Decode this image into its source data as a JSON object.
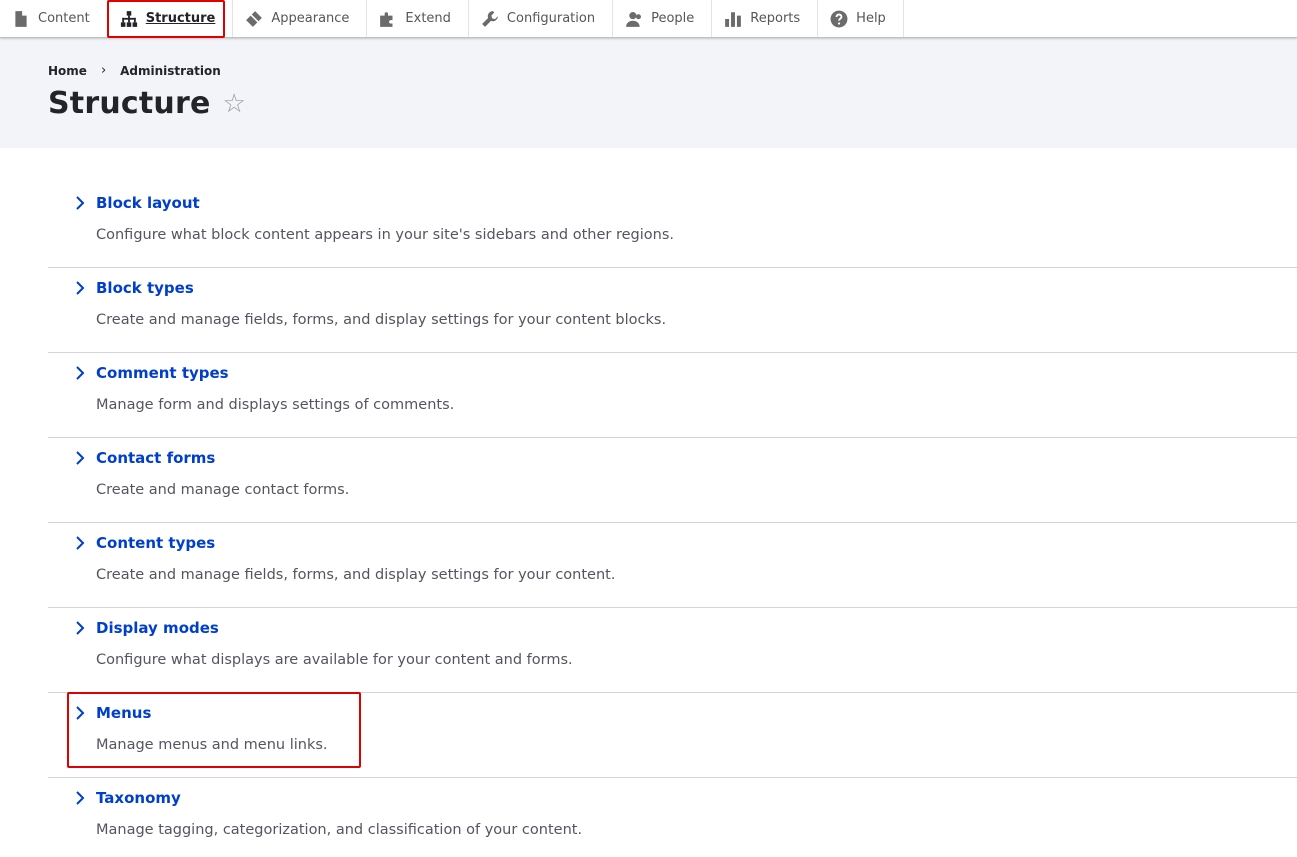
{
  "toolbar": {
    "items": [
      {
        "label": "Content",
        "icon": "file-icon"
      },
      {
        "label": "Structure",
        "icon": "sitemap-icon",
        "active": true
      },
      {
        "label": "Appearance",
        "icon": "brush-icon"
      },
      {
        "label": "Extend",
        "icon": "puzzle-icon"
      },
      {
        "label": "Configuration",
        "icon": "wrench-icon"
      },
      {
        "label": "People",
        "icon": "people-icon"
      },
      {
        "label": "Reports",
        "icon": "bar-chart-icon"
      },
      {
        "label": "Help",
        "icon": "help-icon"
      }
    ]
  },
  "breadcrumb": {
    "home": "Home",
    "separator": "›",
    "admin": "Administration"
  },
  "page": {
    "title": "Structure",
    "star": "☆"
  },
  "admin_list": [
    {
      "title": "Block layout",
      "description": "Configure what block content appears in your site's sidebars and other regions."
    },
    {
      "title": "Block types",
      "description": "Create and manage fields, forms, and display settings for your content blocks."
    },
    {
      "title": "Comment types",
      "description": "Manage form and displays settings of comments."
    },
    {
      "title": "Contact forms",
      "description": "Create and manage contact forms."
    },
    {
      "title": "Content types",
      "description": "Create and manage fields, forms, and display settings for your content."
    },
    {
      "title": "Display modes",
      "description": "Configure what displays are available for your content and forms."
    },
    {
      "title": "Menus",
      "description": "Manage menus and menu links."
    },
    {
      "title": "Taxonomy",
      "description": "Manage tagging, categorization, and classification of your content."
    }
  ],
  "colors": {
    "link": "#003ecc",
    "highlight": "#e00000",
    "header_bg": "#f3f4f9"
  }
}
